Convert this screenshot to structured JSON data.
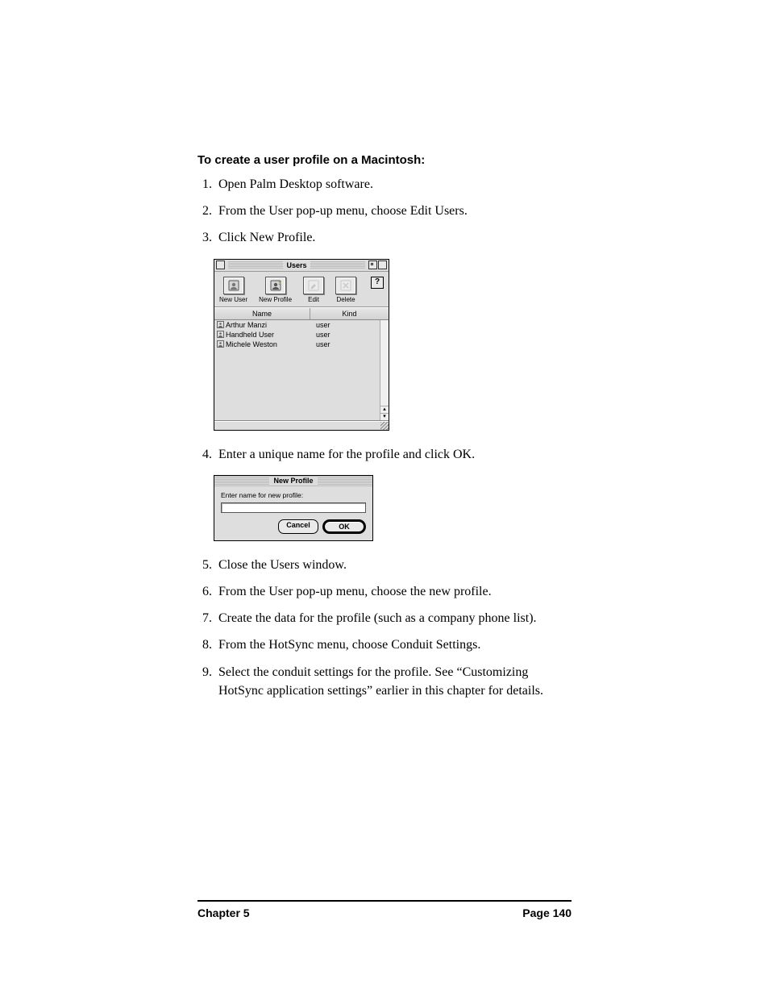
{
  "heading": "To create a user profile on a Macintosh:",
  "steps": [
    "Open Palm Desktop software.",
    "From the User pop-up menu, choose Edit Users.",
    "Click New Profile.",
    "Enter a unique name for the profile and click OK.",
    "Close the Users window.",
    "From the User pop-up menu, choose the new profile.",
    "Create the data for the profile (such as a company phone list).",
    "From the HotSync menu, choose Conduit Settings.",
    "Select the conduit settings for the profile. See “Customizing HotSync application settings” earlier in this chapter for details."
  ],
  "usersWindow": {
    "title": "Users",
    "helpLabel": "?",
    "toolbar": {
      "newUser": "New User",
      "newProfile": "New Profile",
      "edit": "Edit",
      "delete": "Delete"
    },
    "columns": {
      "name": "Name",
      "kind": "Kind"
    },
    "rows": [
      {
        "name": "Arthur Manzi",
        "kind": "user"
      },
      {
        "name": "Handheld User",
        "kind": "user"
      },
      {
        "name": "Michele Weston",
        "kind": "user"
      }
    ]
  },
  "newProfileDialog": {
    "title": "New Profile",
    "prompt": "Enter name for new profile:",
    "cancel": "Cancel",
    "ok": "OK"
  },
  "footer": {
    "chapter": "Chapter 5",
    "page": "Page 140"
  }
}
